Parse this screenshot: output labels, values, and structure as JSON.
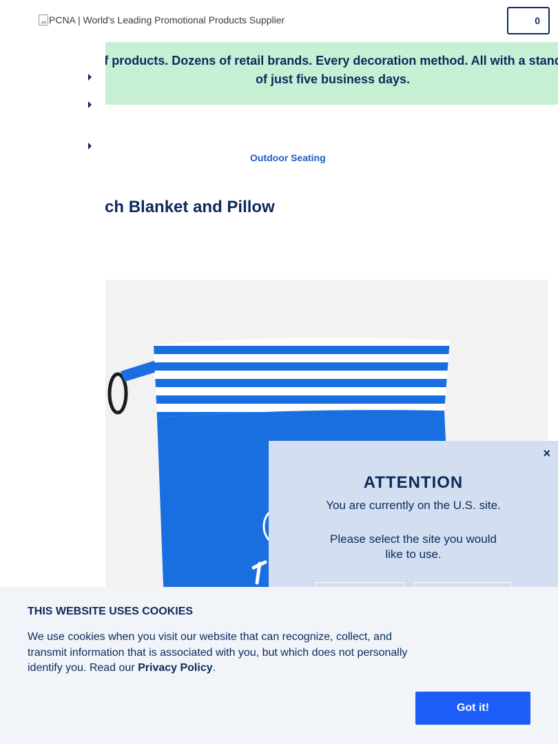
{
  "header": {
    "logo_alt": "PCNA | World's Leading Promotional Products Supplier",
    "cart_count": "0"
  },
  "banner": {
    "text": "Thousands of products. Dozens of retail brands. Every decoration method. All with a standard lead time of just five business days."
  },
  "breadcrumb": {
    "current": "Outdoor Seating"
  },
  "product": {
    "title": "Beach Blanket and Pillow"
  },
  "modal": {
    "close": "×",
    "title": "ATTENTION",
    "line1": "You are currently on the U.S. site.",
    "line2": "Please select the site you would like to use."
  },
  "cookie": {
    "title": "THIS WEBSITE USES COOKIES",
    "text": "We use cookies when you visit our website that can recognize, collect, and transmit information that is associated with you, but which does not personally identify you. Read our ",
    "link": "Privacy Policy",
    "period": ".",
    "button": "Got it!"
  },
  "colors": {
    "navy": "#0b2a5b",
    "banner_bg": "#c7efd4",
    "modal_bg": "#d3dff1",
    "cookie_bg": "#f1f4f9",
    "accent_button": "#1c5cf7",
    "link_blue": "#1f5cc0",
    "product_blue": "#1a6fe0"
  }
}
